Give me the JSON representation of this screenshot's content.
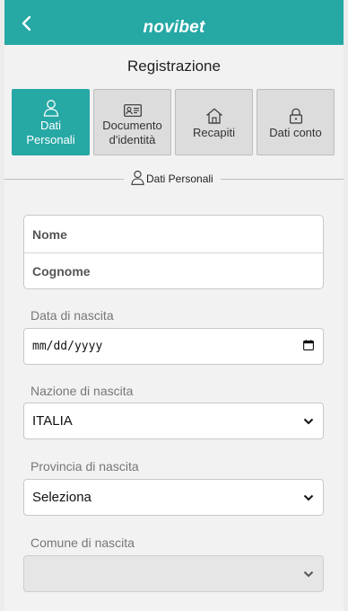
{
  "header": {
    "logo": "novibet"
  },
  "page": {
    "title": "Registrazione"
  },
  "steps": [
    {
      "label_1": "Dati",
      "label_2": "Personali"
    },
    {
      "label_1": "Documento",
      "label_2": "d'identità"
    },
    {
      "label_1": "Recapiti"
    },
    {
      "label_1": "Dati conto"
    }
  ],
  "section": {
    "label": "Dati Personali"
  },
  "form": {
    "nome_placeholder": "Nome",
    "cognome_placeholder": "Cognome",
    "birth_date_label": "Data di nascita",
    "birth_date_value": "mm/dd/yyyy",
    "birth_country_label": "Nazione di nascita",
    "birth_country_value": "ITALIA",
    "birth_province_label": "Provincia di nascita",
    "birth_province_value": "Seleziona",
    "birth_city_label": "Comune di nascita",
    "birth_city_value": ""
  },
  "colors": {
    "brand": "#26a8a5",
    "panel": "#f2f2f2"
  }
}
